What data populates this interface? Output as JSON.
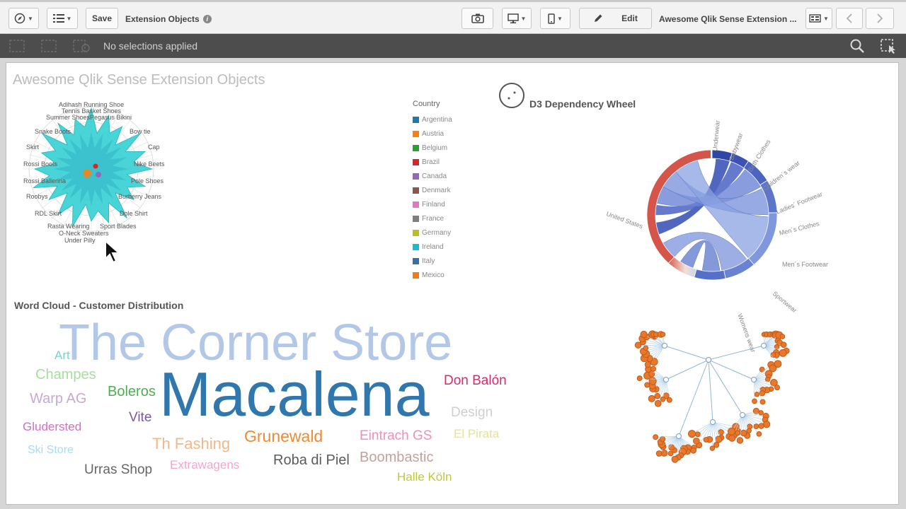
{
  "toolbar": {
    "save_label": "Save",
    "sheet_title": "Extension Objects",
    "edit_label": "Edit",
    "app_title": "Awesome Qlik Sense Extension ..."
  },
  "selections": {
    "status": "No selections applied"
  },
  "sheet": {
    "title": "Awesome Qlik Sense Extension Objects"
  },
  "radar": {
    "labels": [
      "Adihash Running Shoe",
      "Tennis Basket Shoes",
      "Summer Shoes",
      "Pegasus Bikini",
      "Snake Boots",
      "Bow tie",
      "Skirt",
      "Cap",
      "Rossi Boots",
      "Nike Beets",
      "Rossi Ballerina",
      "Pole Shoes",
      "Roobys",
      "Burberry Jeans",
      "RDL Skirt",
      "Dole Shirt",
      "Rasta Wearing",
      "Sport Blades",
      "O-Neck Sweaters",
      "Under Pilly"
    ]
  },
  "legend": {
    "title": "Country",
    "items": [
      {
        "label": "Argentina",
        "color": "#1f77b4"
      },
      {
        "label": "Austria",
        "color": "#ff7f0e"
      },
      {
        "label": "Belgium",
        "color": "#2ca02c"
      },
      {
        "label": "Brazil",
        "color": "#d62728"
      },
      {
        "label": "Canada",
        "color": "#9467bd"
      },
      {
        "label": "Denmark",
        "color": "#8c564b"
      },
      {
        "label": "Finland",
        "color": "#e377c2"
      },
      {
        "label": "France",
        "color": "#7f7f7f"
      },
      {
        "label": "Germany",
        "color": "#bcbd22"
      },
      {
        "label": "Ireland",
        "color": "#17becf"
      },
      {
        "label": "Italy",
        "color": "#3a6ea5"
      },
      {
        "label": "Mexico",
        "color": "#f07b1d"
      }
    ]
  },
  "dependency_wheel": {
    "title": "D3 Dependency Wheel",
    "labels": [
      "Underwear",
      "Babywear",
      "Bath Clothes",
      "Children´s wear",
      "Ladies´ Footwear",
      "Men´s Clothes",
      "Men´s Footwear",
      "Sportwear",
      "Womens wear",
      "United States"
    ]
  },
  "word_cloud": {
    "title": "Word Cloud - Customer Distribution",
    "words": [
      {
        "text": "The Corner Store",
        "color": "#b3c7e6"
      },
      {
        "text": "Macalena",
        "color": "#2f77ad"
      },
      {
        "text": "Art",
        "color": "#77d3cf"
      },
      {
        "text": "Champes",
        "color": "#a5df9c"
      },
      {
        "text": "Warp AG",
        "color": "#c6a9d6"
      },
      {
        "text": "Boleros",
        "color": "#4caf50"
      },
      {
        "text": "Gludersted",
        "color": "#d36ec1"
      },
      {
        "text": "Vite",
        "color": "#7a55b0"
      },
      {
        "text": "Ski Store",
        "color": "#a8dde6"
      },
      {
        "text": "Urras Shop",
        "color": "#666666"
      },
      {
        "text": "Th Fashing",
        "color": "#f2b88a"
      },
      {
        "text": "Grunewald",
        "color": "#ee8a36"
      },
      {
        "text": "Extrawagens",
        "color": "#f2a6cf"
      },
      {
        "text": "Roba di Piel",
        "color": "#5b5b5b"
      },
      {
        "text": "Eintrach GS",
        "color": "#ef8fb8"
      },
      {
        "text": "Boombastic",
        "color": "#c3a29a"
      },
      {
        "text": "Halle Köln",
        "color": "#bcc93d"
      },
      {
        "text": "El Pirata",
        "color": "#e4e29d"
      },
      {
        "text": "Design",
        "color": "#cfcfcf"
      },
      {
        "text": "Don Balón",
        "color": "#d62a6a"
      }
    ]
  }
}
